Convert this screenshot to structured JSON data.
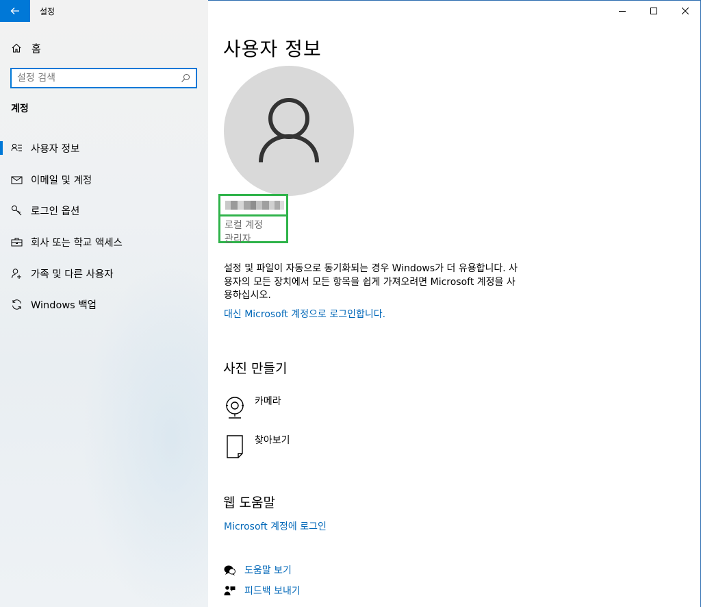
{
  "window": {
    "app_title": "설정",
    "minimize_glyph": "─",
    "maximize_glyph": "☐",
    "close_glyph": "✕"
  },
  "sidebar": {
    "home_label": "홈",
    "search_placeholder": "설정 검색",
    "section_title": "계정",
    "items": [
      {
        "label": "사용자 정보",
        "icon": "person-info-icon",
        "active": true
      },
      {
        "label": "이메일 및 계정",
        "icon": "mail-icon",
        "active": false
      },
      {
        "label": "로그인 옵션",
        "icon": "key-icon",
        "active": false
      },
      {
        "label": "회사 또는 학교 액세스",
        "icon": "briefcase-icon",
        "active": false
      },
      {
        "label": "가족 및 다른 사용자",
        "icon": "person-add-icon",
        "active": false
      },
      {
        "label": "Windows 백업",
        "icon": "sync-icon",
        "active": false
      }
    ]
  },
  "main": {
    "title": "사용자 정보",
    "account_type": "로컬 계정",
    "account_role": "관리자",
    "description": "설정 및 파일이 자동으로 동기화되는 경우 Windows가 더 유용합니다. 사용자의 모든 장치에서 모든 항목을 쉽게 가져오려면 Microsoft 계정을 사용하십시오.",
    "signin_link": "대신 Microsoft 계정으로 로그인합니다.",
    "create_photo_title": "사진 만들기",
    "camera_label": "카메라",
    "browse_label": "찾아보기",
    "web_help_title": "웹 도움말",
    "ms_signin_link": "Microsoft 계정에 로그인",
    "get_help_label": "도움말 보기",
    "feedback_label": "피드백 보내기"
  },
  "colors": {
    "accent": "#0078d7",
    "link": "#0067b8",
    "highlight_box": "#2fb34a"
  }
}
